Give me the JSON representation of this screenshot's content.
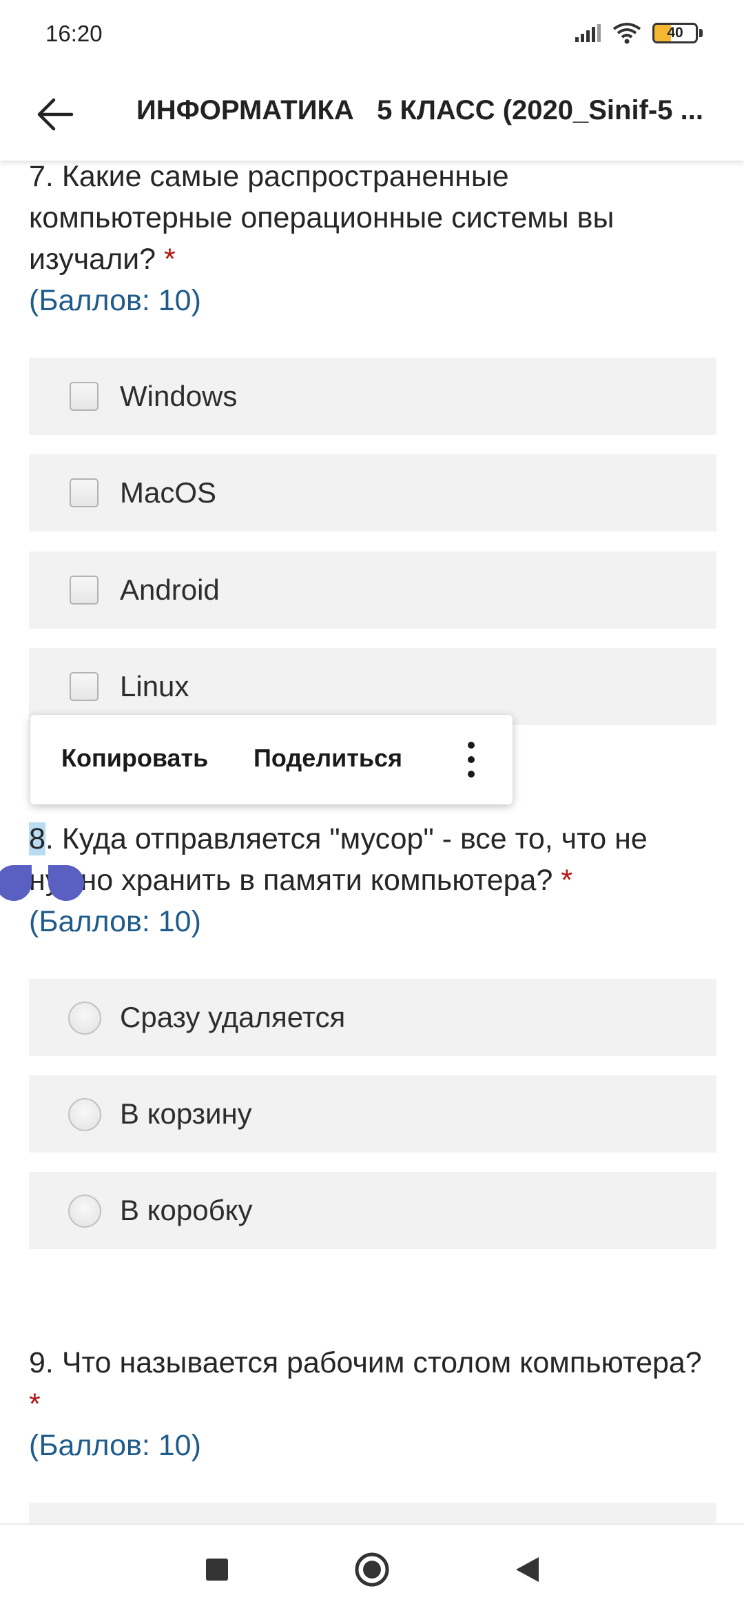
{
  "status_bar": {
    "time": "16:20",
    "battery_level": "40",
    "battery_fraction": 0.4,
    "icons": [
      "signal-icon",
      "wifi-icon",
      "battery-icon"
    ]
  },
  "app_bar": {
    "title": "ИНФОРМАТИКА   5 КЛАСС (2020_Sinif-5 ...",
    "back_icon": "arrow-left-icon"
  },
  "questions": [
    {
      "number": "7",
      "text": ". Какие самые распространенные компьютерные операционные системы вы изучали?",
      "required_mark": "*",
      "points": "(Баллов: 10)",
      "type": "checkbox",
      "options": [
        "Windows",
        "MacOS",
        "Android",
        "Linux"
      ]
    },
    {
      "number": "8",
      "text": ". Куда отправляется \"мусор\" - все то, что не нужно хранить в памяти компьютера?",
      "required_mark": "*",
      "points": "(Баллов: 10)",
      "type": "radio",
      "options": [
        "Сразу удаляется",
        "В корзину",
        "В коробку"
      ]
    },
    {
      "number": "9",
      "text": ". Что называется рабочим столом компьютера?",
      "required_mark": "*",
      "points": "(Баллов: 10)",
      "type": "radio",
      "options": []
    }
  ],
  "context_menu": {
    "copy": "Копировать",
    "share": "Поделиться",
    "more_icon": "more-vert-icon"
  },
  "nav_bar": {
    "icons": [
      "recents-square-icon",
      "home-circle-icon",
      "back-triangle-icon"
    ]
  },
  "colors": {
    "accent_points": "#1f5c8b",
    "required": "#b31412",
    "option_bg": "#f2f2f2",
    "selection": "#b9dcf3",
    "selection_handle": "#5a5fc2"
  }
}
